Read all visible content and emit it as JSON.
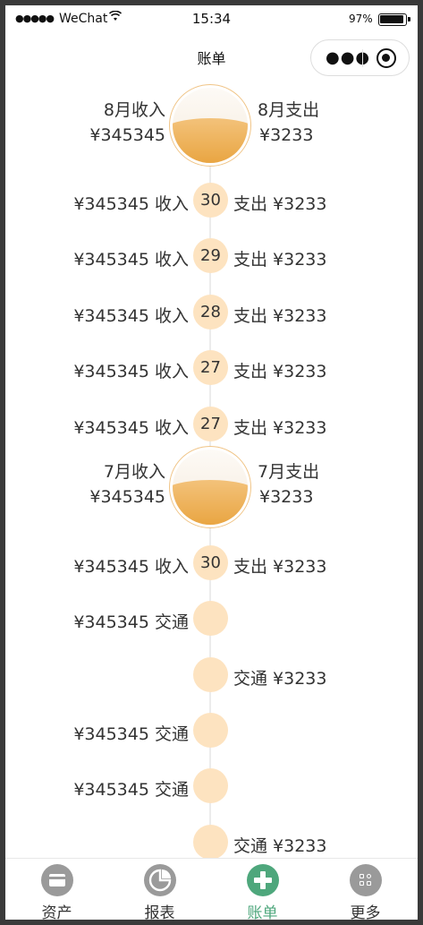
{
  "status_bar": {
    "signal": "●●●●●",
    "carrier": "WeChat",
    "time": "15:34",
    "battery_text": "97%",
    "battery_level": 0.97
  },
  "nav": {
    "title": "账单",
    "more_icon": "more-dots-icon",
    "close_icon": "target-circle-icon"
  },
  "timeline": {
    "months": [
      {
        "income_label": "8月收入",
        "income_value": "¥345345",
        "expense_label": "8月支出",
        "expense_value": "¥3233"
      },
      {
        "income_label": "7月收入",
        "income_value": "¥345345",
        "expense_label": "7月支出",
        "expense_value": "¥3233"
      }
    ],
    "aug_days": [
      {
        "day": "30",
        "left": "¥345345  收入",
        "right": "支出  ¥3233"
      },
      {
        "day": "29",
        "left": "¥345345  收入",
        "right": "支出  ¥3233"
      },
      {
        "day": "28",
        "left": "¥345345  收入",
        "right": "支出  ¥3233"
      },
      {
        "day": "27",
        "left": "¥345345  收入",
        "right": "支出  ¥3233"
      },
      {
        "day": "27",
        "left": "¥345345  收入",
        "right": "支出  ¥3233"
      }
    ],
    "jul_days": [
      {
        "day": "30",
        "left": "¥345345  收入",
        "right": "支出  ¥3233"
      },
      {
        "day": "",
        "left": "¥345345  交通",
        "right": ""
      },
      {
        "day": "",
        "left": "",
        "right": "交通  ¥3233"
      },
      {
        "day": "",
        "left": "¥345345  交通",
        "right": ""
      },
      {
        "day": "",
        "left": "¥345345  交通",
        "right": ""
      },
      {
        "day": "",
        "left": "",
        "right": "交通  ¥3233"
      }
    ]
  },
  "tabbar": {
    "items": [
      {
        "label": "资产",
        "icon": "wallet-icon"
      },
      {
        "label": "报表",
        "icon": "pie-chart-icon"
      },
      {
        "label": "账单",
        "icon": "plus-circle-icon",
        "active": true
      },
      {
        "label": "更多",
        "icon": "grid-icon"
      }
    ],
    "active_color": "#4ea77c",
    "inactive_color": "#9a9a9a"
  }
}
